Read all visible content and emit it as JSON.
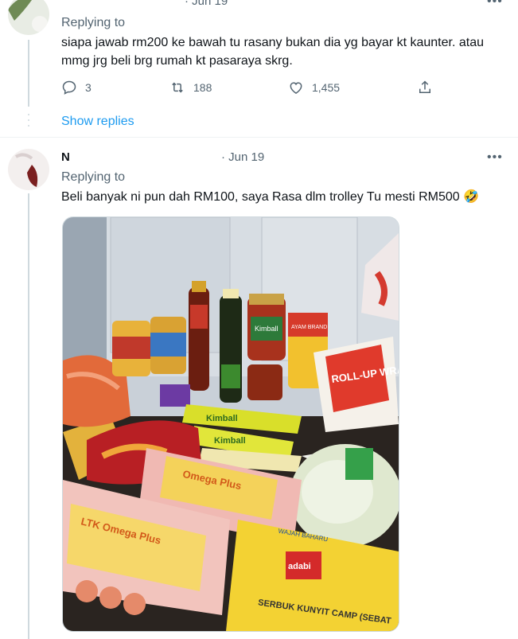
{
  "tweet1": {
    "date": "· Jun 19",
    "replying_to": "Replying to",
    "text": "siapa jawab rm200 ke bawah tu rasany bukan dia yg bayar kt kaunter. atau mmg jrg beli brg rumah kt pasaraya skrg.",
    "replies": "3",
    "retweets": "188",
    "likes": "1,455",
    "show_replies": "Show replies"
  },
  "tweet2": {
    "name": "N",
    "date": "· Jun 19",
    "replying_to": "Replying to",
    "text": "Beli banyak ni pun dah RM100, saya Rasa dlm trolley Tu mesti RM500 🤣"
  },
  "icons": {
    "reply": "reply-icon",
    "retweet": "retweet-icon",
    "like": "heart-icon",
    "share": "share-icon",
    "more": "more-icon"
  },
  "photo_text": {
    "kimball_1": "Kimball",
    "kimball_2": "Kimball",
    "kimball_3": "Kimball",
    "rollup": "ROLL-UP WRAPS",
    "eggs_1": "LTK Omega Plus",
    "eggs_2": "Omega Plus",
    "adabi": "adabi",
    "serbuk": "SERBUK KUNYIT CAMP (SEBAT",
    "ayam_brand": "AYAM BRAND",
    "wajah_baru": "WAJAH BAHARU"
  },
  "colors": {
    "link": "#1d9bf0",
    "muted": "#536471",
    "text": "#0f1419"
  }
}
